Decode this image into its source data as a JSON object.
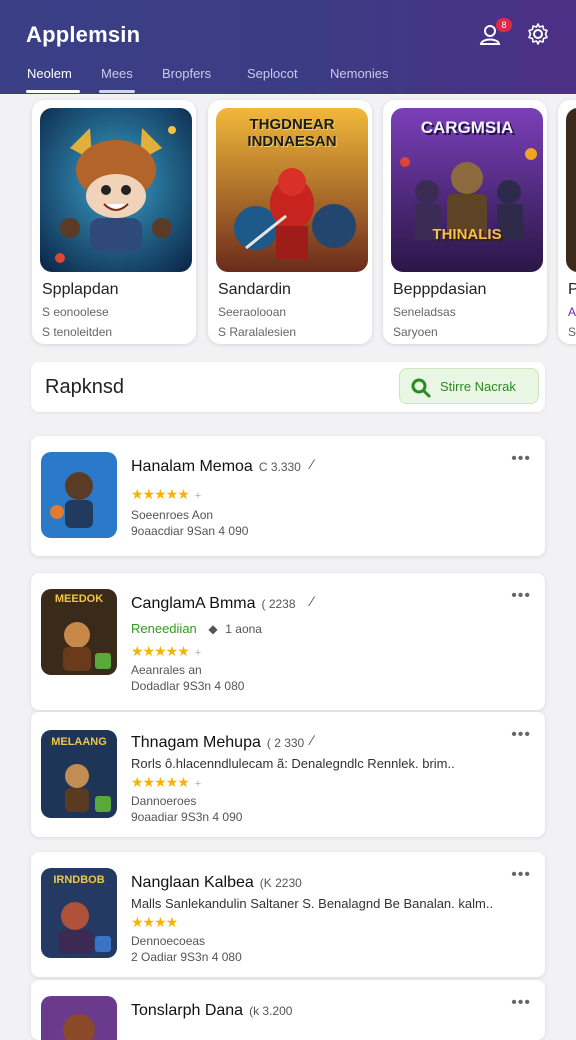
{
  "app": {
    "title": "Applemsin",
    "notifications_badge": "8",
    "accent_color": "#3b3d84"
  },
  "tabs": [
    {
      "label": "Neolem",
      "active": true
    },
    {
      "label": "Mees",
      "active": false
    },
    {
      "label": "Bropfers",
      "active": false
    },
    {
      "label": "Seplocot",
      "active": false
    },
    {
      "label": "Nemonies",
      "active": false
    }
  ],
  "featured": [
    {
      "name": "Spplapdan",
      "line1": "S eonoolese",
      "line2": "S tenoleitden",
      "art_text": ""
    },
    {
      "name": "Sandardin",
      "line1": "Seeraolooan",
      "line2": "S Raralalesien",
      "art_text": "THGDNEAR INDNAESAN"
    },
    {
      "name": "Bepppdasian",
      "line1": "Seneladsas",
      "line2": "Saryoen",
      "art_text": "CARGMSIA",
      "art_text2": "THINALIS"
    },
    {
      "name": "P",
      "line1": "A",
      "line2": "S",
      "art_text": ""
    }
  ],
  "section": {
    "title": "Rapknsd",
    "button_label": "Stirre Nacrak"
  },
  "list": [
    {
      "title": "Hanalam Memoa",
      "version": "C 3.330",
      "line_a": "Soeenroes Aon",
      "line_b": "9oaacdiar 9San  4 090",
      "stars": "★★★★★",
      "desc": "",
      "green": "",
      "icon_text": ""
    },
    {
      "title": "CanglamA Bmma",
      "version": "( 2238",
      "green": "Reneediian",
      "green_extra": "1 aona",
      "line_a": "Aeanrales an",
      "line_b": "Dodadlar 9S3n  4 080",
      "stars": "★★★★★",
      "desc": "",
      "icon_text": "MEEDOK"
    },
    {
      "title": "Thnagam Mehupa",
      "version": "( 2 330",
      "desc": "Rorls ô.hlacenndlulecam ã: Denalegndlc Rennlek. brim..",
      "line_a": "Dannoeroes",
      "line_b": "9oaadiar 9S3n  4 090",
      "stars": "★★★★★",
      "green": "",
      "icon_text": "MELAANG"
    },
    {
      "title": "Nanglaan Kalbea",
      "version": "(K 2230",
      "desc": "Malls Sanlekandulin Saltaner S. Benalagnd Be Banalan. kalm..",
      "line_a": "Dennoecoeas",
      "line_b": "2 Oadiar 9S3n  4 080",
      "stars": "★★★★",
      "green": "",
      "icon_text": "IRNDBOB"
    },
    {
      "title": "Tonslarph Dana",
      "version": "(k 3.200",
      "desc": "",
      "line_a": "",
      "line_b": "",
      "stars": "",
      "green": "",
      "icon_text": ""
    }
  ]
}
